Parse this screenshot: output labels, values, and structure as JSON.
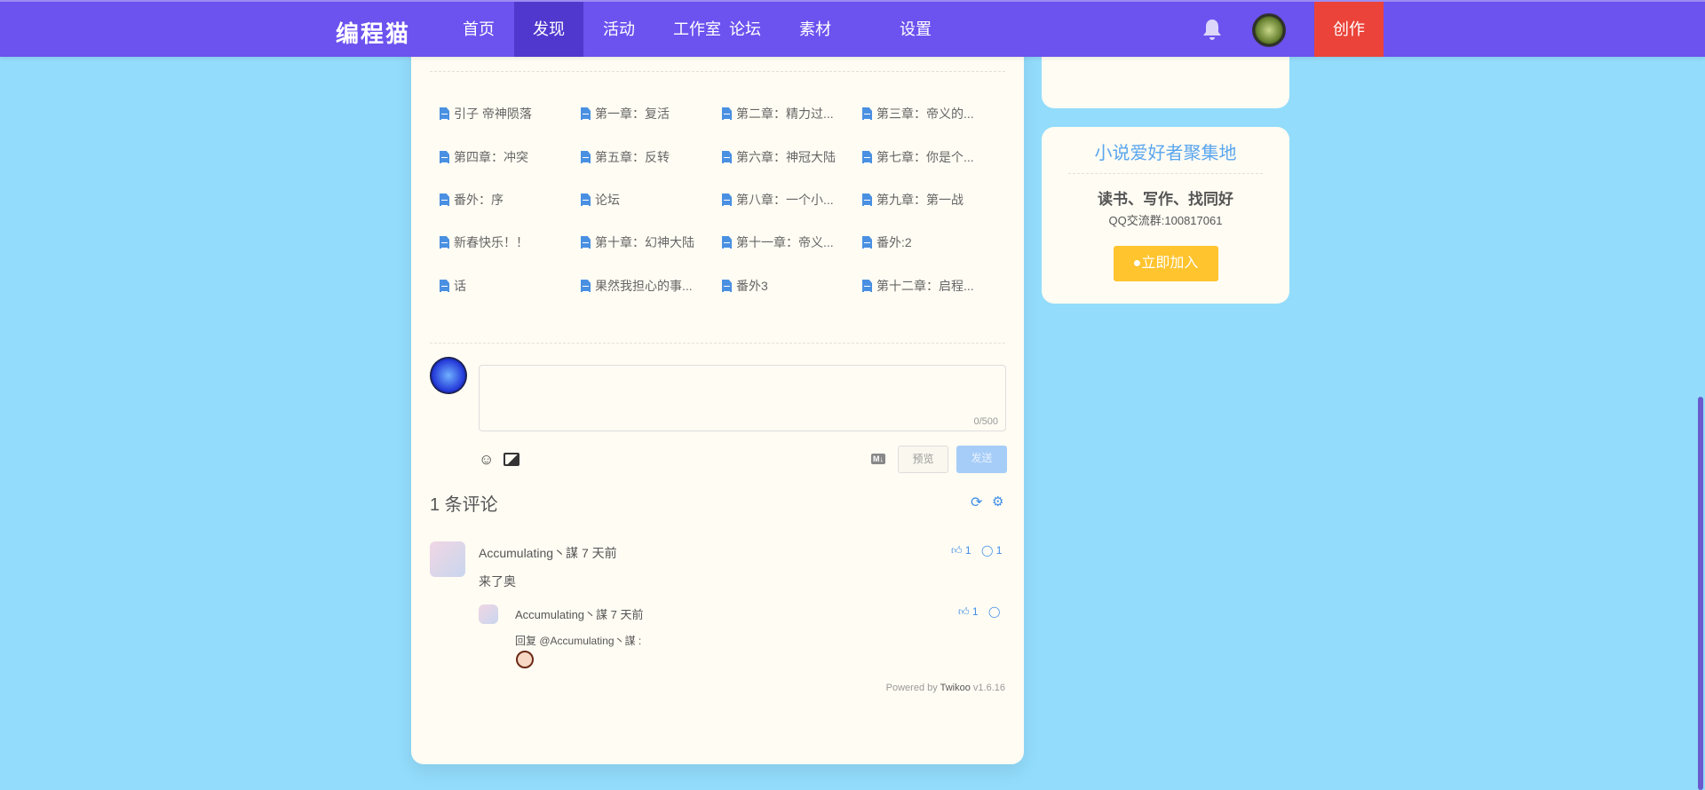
{
  "nav": {
    "logo": "编程猫",
    "items": [
      "首页",
      "发现",
      "活动",
      "工作室",
      "论坛",
      "素材",
      "设置"
    ],
    "active": "发现",
    "create": "创作"
  },
  "docs": [
    "引子 帝神陨落",
    "第一章：复活",
    "第二章：精力过...",
    "第三章：帝义的...",
    "第四章：冲突",
    "第五章：反转",
    "第六章：神冠大陆",
    "第七章：你是个...",
    "番外：序",
    "论坛",
    "第八章：一个小...",
    "第九章：第一战",
    "新春快乐！！",
    "第十章：幻神大陆",
    "第十一章：帝义...",
    "番外:2",
    "话",
    "果然我担心的事...",
    "番外3",
    "第十二章：启程..."
  ],
  "editor": {
    "counter": "0/500",
    "preview": "预览",
    "send": "发送",
    "md": "M↓"
  },
  "comments": {
    "count_label": "1 条评论",
    "items": [
      {
        "author": "Accumulating丶謀",
        "time": "7 天前",
        "content": "来了奥",
        "likes": "1",
        "replies": "1",
        "reply": {
          "author": "Accumulating丶謀",
          "time": "7 天前",
          "content": "回复 @Accumulating丶謀 :",
          "likes": "1"
        }
      }
    ],
    "powered_prefix": "Powered by ",
    "powered_name": "Twikoo",
    "powered_version": " v1.6.16"
  },
  "sidebar": {
    "group_title": "小说爱好者聚集地",
    "slogan": "读书、写作、找同好",
    "qq": "QQ交流群:100817061",
    "join": "立即加入"
  },
  "colors": {
    "nav": "#6c52ef",
    "active": "#5038cf",
    "create": "#eb4339",
    "join": "#ffc42e",
    "accent": "#4a90e2"
  }
}
